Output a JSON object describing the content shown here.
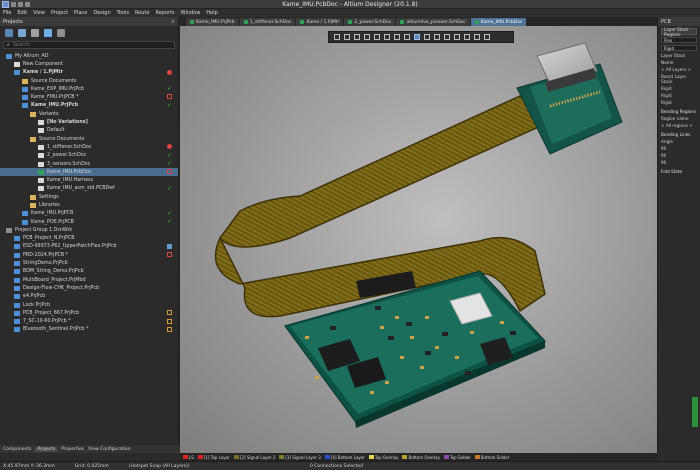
{
  "window": {
    "title": "Kame_IMU.PcbDoc - Altium Designer (20.1.8)"
  },
  "menu": [
    "File",
    "Edit",
    "View",
    "Project",
    "Place",
    "Design",
    "Tools",
    "Route",
    "Reports",
    "Window",
    "Help"
  ],
  "projects_panel": {
    "title": "Projects",
    "search_placeholder": "Search",
    "tree": [
      {
        "label": "My Altium_AD",
        "level": 0,
        "icon": "proj"
      },
      {
        "label": "New Component",
        "level": 1,
        "icon": "doc"
      },
      {
        "label": "Kame / 1.PjMtr",
        "level": 1,
        "icon": "proj",
        "status": "red",
        "bold": true
      },
      {
        "label": "Source Documents",
        "level": 2,
        "icon": "folder"
      },
      {
        "label": "Kame_EXP_IMU.PrjPcb",
        "level": 2,
        "icon": "proj",
        "status": "grn"
      },
      {
        "label": "Kame_FMU.PrjPCB *",
        "level": 2,
        "icon": "proj",
        "status": "redsq"
      },
      {
        "label": "Kame_IMU.PrjPcb",
        "level": 2,
        "icon": "proj",
        "status": "grn",
        "bold": true
      },
      {
        "label": "Variants",
        "level": 3,
        "icon": "folder"
      },
      {
        "label": "[No Variations]",
        "level": 4,
        "icon": "doc",
        "bold": true
      },
      {
        "label": "Default",
        "level": 4,
        "icon": "doc"
      },
      {
        "label": "Source Documents",
        "level": 3,
        "icon": "folder"
      },
      {
        "label": "1_stiffener.SchDoc",
        "level": 4,
        "icon": "doc",
        "status": "red"
      },
      {
        "label": "2_power.SchDoc",
        "level": 4,
        "icon": "doc",
        "status": "grn"
      },
      {
        "label": "3_sensors.SchDoc",
        "level": 4,
        "icon": "doc",
        "status": "grn"
      },
      {
        "label": "Kame_IMU.PcbDoc",
        "level": 4,
        "icon": "pcb",
        "status": "redsq",
        "selected": true
      },
      {
        "label": "Kame_IMU.Harness",
        "level": 4,
        "icon": "doc"
      },
      {
        "label": "Kame_IMU_asm_std.PCBDwf",
        "level": 4,
        "icon": "doc",
        "status": "grn"
      },
      {
        "label": "Settings",
        "level": 3,
        "icon": "folder"
      },
      {
        "label": "Libraries",
        "level": 3,
        "icon": "folder"
      },
      {
        "label": "Kame_IMU.PrjPCB",
        "level": 2,
        "icon": "proj",
        "status": "grn"
      },
      {
        "label": "Kame_POE.PrjPCB",
        "level": 2,
        "icon": "proj",
        "status": "grn"
      },
      {
        "label": "Project Group 1.DsnWrk",
        "level": 0,
        "icon": "grp"
      },
      {
        "label": "PCB_Project_N.PrjPCB",
        "level": 1,
        "icon": "proj"
      },
      {
        "label": "ESD-99973-P62_UpperPatchFlex.PrjPcb",
        "level": 1,
        "icon": "proj",
        "status": "blue"
      },
      {
        "label": "PRD-2024.PrjPCB *",
        "level": 1,
        "icon": "proj",
        "status": "redsq"
      },
      {
        "label": "StringDemo.PrjPcb",
        "level": 1,
        "icon": "proj"
      },
      {
        "label": "BOM_String_Demo.PrjPcb",
        "level": 1,
        "icon": "proj"
      },
      {
        "label": "MultiBoard_Project.PrjMbd",
        "level": 1,
        "icon": "proj"
      },
      {
        "label": "Design-Flow-CHK_Project.PrjPcb",
        "level": 1,
        "icon": "proj"
      },
      {
        "label": "e4.PrjPcb",
        "level": 1,
        "icon": "proj"
      },
      {
        "label": "Lock.PrjPcb",
        "level": 1,
        "icon": "proj"
      },
      {
        "label": "PCB_Project_667.PrjPcb",
        "level": 1,
        "icon": "proj",
        "status": "orange"
      },
      {
        "label": "7_SC-10-60.PrjPcb *",
        "level": 1,
        "icon": "proj",
        "status": "orange"
      },
      {
        "label": "Bluetooth_Sentinel.PrjPcb *",
        "level": 1,
        "icon": "proj",
        "status": "orange"
      }
    ],
    "bottom_tabs": [
      "Components",
      "Projects",
      "Properties",
      "View Configuration"
    ]
  },
  "doc_tabs": [
    {
      "label": "Kame_IMU.PrjPcb",
      "active": false
    },
    {
      "label": "1_stiffener.SchDoc",
      "active": false
    },
    {
      "label": "Kame / 1.PjMtr",
      "active": false
    },
    {
      "label": "2_power.SchDoc",
      "active": false
    },
    {
      "label": "altiumlive_pioneer.SchDoc",
      "active": false
    },
    {
      "label": "Kame_IMU.PcbDoc",
      "active": true
    }
  ],
  "properties_panel": {
    "title": "PCB",
    "sections": [
      {
        "type": "btn",
        "text": "Layer Stack Regions"
      },
      {
        "type": "dd",
        "text": "Flex"
      },
      {
        "type": "dd",
        "text": "Rigid"
      },
      {
        "type": "sec",
        "text": "Layer Stack"
      },
      {
        "type": "sec",
        "text": "Name"
      },
      {
        "type": "sec",
        "text": "< All Layers >"
      },
      {
        "type": "sec",
        "text": "Board Layer Stack"
      },
      {
        "type": "sec",
        "text": "Rigid"
      },
      {
        "type": "sec",
        "text": "Rigid"
      },
      {
        "type": "sec",
        "text": "Rigid"
      },
      {
        "type": "sec",
        "text": "Bending Regions",
        "title": true
      },
      {
        "type": "sec",
        "text": "Region name"
      },
      {
        "type": "sec",
        "text": "< All regions >"
      },
      {
        "type": "sec",
        "text": "Bending Lines",
        "title": true
      },
      {
        "type": "sec",
        "text": "Angle"
      },
      {
        "type": "sec",
        "text": "90"
      },
      {
        "type": "sec",
        "text": "90"
      },
      {
        "type": "sec",
        "text": "90"
      },
      {
        "type": "sec",
        "text": "Fold State",
        "title": true
      }
    ]
  },
  "layers": [
    {
      "label": "LS",
      "color": "#d22"
    },
    {
      "label": "[1] Top Layer",
      "color": "#d22"
    },
    {
      "label": "[2] Signal Layer 2",
      "color": "#7d6b2f"
    },
    {
      "label": "[3] Signal Layer 3",
      "color": "#7a7a2a"
    },
    {
      "label": "[4] Bottom Layer",
      "color": "#2a4fd0"
    },
    {
      "label": "Top Overlay",
      "color": "#e7d84b"
    },
    {
      "label": "Bottom Overlay",
      "color": "#b3a32f"
    },
    {
      "label": "Top Solder",
      "color": "#8c4ea8"
    },
    {
      "label": "Bottom Solder",
      "color": "#c07b2b"
    }
  ],
  "status": {
    "coords": "X:45.97mm Y:-36.3mm",
    "grid": "Grid: 0.025mm",
    "info": "(Hotspot Snap (All Layers))",
    "selected": "0 Connections Selected"
  }
}
